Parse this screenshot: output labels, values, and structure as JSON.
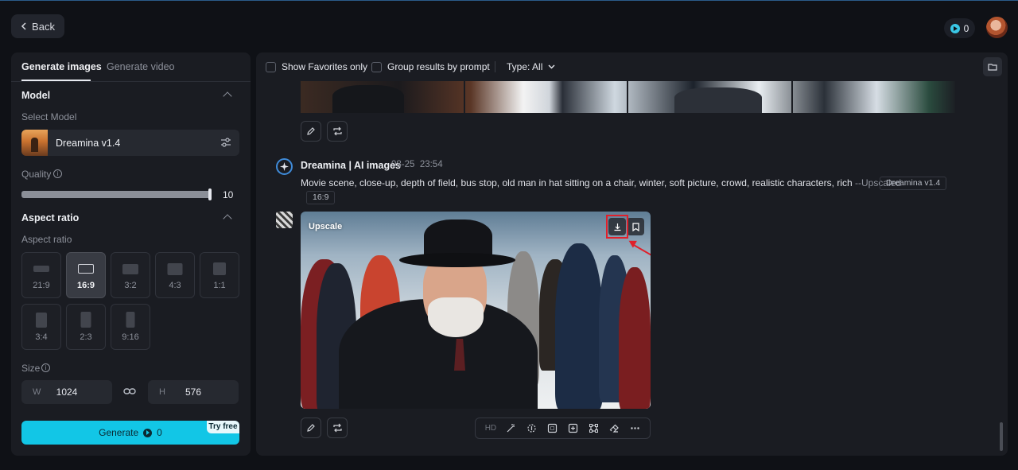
{
  "header": {
    "back_label": "Back",
    "credits": "0"
  },
  "left_panel": {
    "tabs": [
      {
        "label": "Generate images",
        "active": true
      },
      {
        "label": "Generate video",
        "active": false
      }
    ],
    "model": {
      "section_title": "Model",
      "select_label": "Select Model",
      "selected_model": "Dreamina v1.4"
    },
    "quality": {
      "label": "Quality",
      "value": "10"
    },
    "aspect_ratio": {
      "section_title": "Aspect ratio",
      "sub_label": "Aspect ratio",
      "options": [
        "21:9",
        "16:9",
        "3:2",
        "4:3",
        "1:1",
        "3:4",
        "2:3",
        "9:16"
      ],
      "selected": "16:9"
    },
    "size": {
      "label": "Size",
      "w_label": "W",
      "w_value": "1024",
      "h_label": "H",
      "h_value": "576"
    },
    "generate": {
      "label": "Generate",
      "cost": "0",
      "badge": "Try free"
    }
  },
  "right_panel": {
    "filters": {
      "show_favorites": "Show Favorites only",
      "group_by_prompt": "Group results by prompt",
      "type_label": "Type: All"
    },
    "message": {
      "sender": "Dreamina | AI images",
      "date": "08-25",
      "time": "23:54",
      "prompt": "Movie scene, close-up, depth of field, bus stop, old man in hat sitting on a chair, winter, soft picture, crowd, realistic characters, rich",
      "prompt_suffix": "--Upscaled",
      "model_tag": "Dreamina v1.4",
      "ratio_tag": "16:9"
    },
    "image": {
      "overlay_label": "Upscale"
    },
    "toolbar": {
      "hd_label": "HD"
    }
  },
  "colors": {
    "accent": "#12c6e6",
    "highlight": "#e0202a",
    "panel_bg": "#1a1c22",
    "page_bg": "#0f1116"
  }
}
